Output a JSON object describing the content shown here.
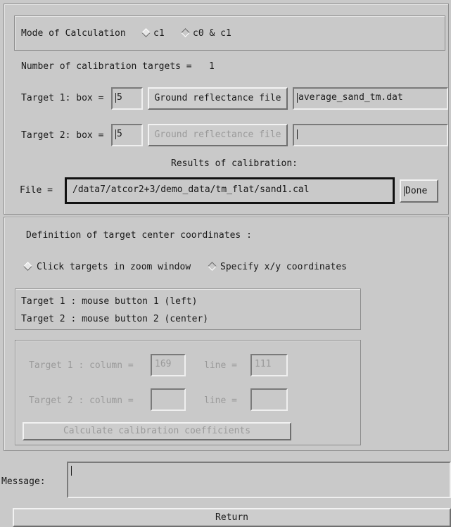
{
  "mode": {
    "label": "Mode of Calculation",
    "option_c1": "c1",
    "option_c0c1": "c0 & c1",
    "selected": "c1"
  },
  "targets_count": {
    "label": "Number of calibration targets =",
    "value": "1"
  },
  "target1": {
    "box_label": "Target 1: box =",
    "box_value": "5",
    "ground_button": "Ground reflectance file",
    "file_value": "average_sand_tm.dat"
  },
  "target2": {
    "box_label": "Target 2: box =",
    "box_value": "5",
    "ground_button": "Ground reflectance file",
    "file_value": ""
  },
  "results": {
    "heading": "Results of calibration:",
    "file_label": "File =",
    "file_value": "/data7/atcor2+3/demo_data/tm_flat/sand1.cal",
    "done_button": "Done"
  },
  "definition": {
    "heading": "Definition of target center coordinates :",
    "option_click": "Click targets in zoom window",
    "option_specify": "Specify x/y coordinates",
    "selected": "click"
  },
  "mouse_info": {
    "line1": "Target 1 : mouse button 1 (left)",
    "line2": "Target 2 : mouse button 2 (center)"
  },
  "coords": {
    "t1_col_label": "Target 1 : column =",
    "t1_col_value": "169",
    "t1_line_label": "line =",
    "t1_line_value": "111",
    "t2_col_label": "Target 2 : column =",
    "t2_col_value": "",
    "t2_line_label": "line =",
    "t2_line_value": "",
    "calc_button": "Calculate calibration coefficients"
  },
  "message": {
    "label": "Message:",
    "value": ""
  },
  "return_button": "Return"
}
